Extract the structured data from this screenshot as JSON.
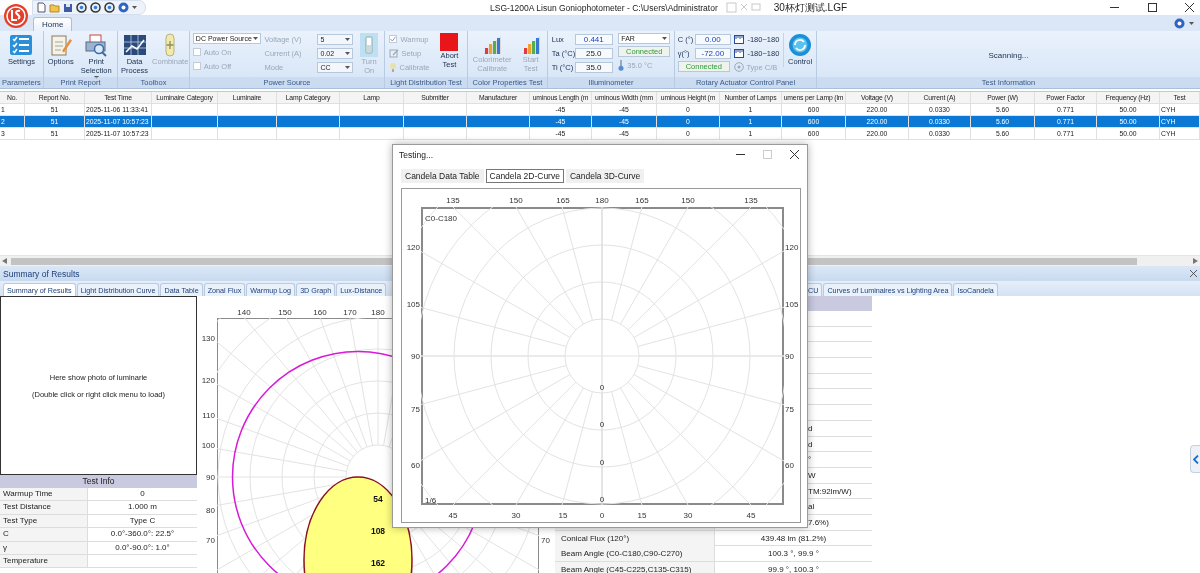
{
  "title_bar": {
    "title": "LSG-1200A Lisun Goniophotometer  - C:\\Users\\Administrator",
    "title_end": "30杯灯测试.LGF"
  },
  "ribbon": {
    "tabs": [
      {
        "label": "Home",
        "selected": true
      }
    ],
    "parameters": {
      "label": "Parameters",
      "settings": {
        "label": "Settings"
      }
    },
    "print_report": {
      "label": "Print Report",
      "options": {
        "label": "Options"
      },
      "print_selection": {
        "label": "Print Selection"
      }
    },
    "toolbox": {
      "label": "Toolbox",
      "data_process": {
        "label": "Data Process",
        "disabled": false
      },
      "combinate": {
        "label": "Combinate",
        "disabled": true
      }
    },
    "power_source": {
      "label": "Power Source",
      "source": {
        "value": "DC Power Source"
      },
      "auto_on": {
        "label": "Auto On",
        "checked": false,
        "disabled": true
      },
      "auto_off": {
        "label": "Auto Off",
        "checked": false,
        "disabled": true
      },
      "fields": [
        {
          "label": "Voltage (V)",
          "value": "5",
          "disabled": true
        },
        {
          "label": "Current (A)",
          "value": "0.02",
          "disabled": true
        },
        {
          "label": "Mode",
          "value": "CC",
          "disabled": true
        }
      ],
      "turn_on": {
        "label": "Turn On",
        "disabled": true
      }
    },
    "light_distribution": {
      "label": "Light Distribution Test",
      "warmup": {
        "label": "Warmup",
        "checked": true,
        "disabled": true
      },
      "setup": {
        "label": "Setup",
        "disabled": true
      },
      "calibrate": {
        "label": "Calibrate",
        "disabled": true
      },
      "abort": {
        "label": "Abort Test",
        "disabled": false
      }
    },
    "color_properties": {
      "label": "Color Properties Test",
      "colorimeter": {
        "label": "Colorimeter Calibrate",
        "disabled": true
      },
      "start": {
        "label": "Start Test",
        "disabled": true
      }
    },
    "illuminometer": {
      "label": "Illuminometer",
      "readings": [
        {
          "label": "Lux",
          "value": "0.441"
        },
        {
          "label": "Ta (°C)",
          "value": "25.0"
        },
        {
          "label": "Ti (°C)",
          "value": "35.0"
        }
      ],
      "range": {
        "value": "FAR"
      },
      "status": "Connected",
      "temperature": "35.0 °C"
    },
    "rotary": {
      "label": "Rotary Actuator Control Panel",
      "readings": [
        {
          "label": "C (°)",
          "value": "0.00"
        },
        {
          "label": "γ(°)",
          "value": "-72.00"
        }
      ],
      "status": "Connected",
      "ranges": [
        "-180~180",
        "-180~180"
      ],
      "type": {
        "label": "Type C/B",
        "disabled": true
      },
      "control": {
        "label": "Control",
        "disabled": false
      }
    },
    "test_information": {
      "label": "Test Information",
      "status": "Scanning..."
    }
  },
  "results_table": {
    "columns": [
      "No.",
      "Report No.",
      "Test Time",
      "Luminaire Category",
      "Luminaire",
      "Lamp Category",
      "Lamp",
      "Submitter",
      "Manufacturer",
      "uminous Length (m",
      "uminous Width (mm",
      "uminous Height (m",
      "Number of Lamps",
      "umens per Lamp (lm",
      "Voltage (V)",
      "Current (A)",
      "Power (W)",
      "Power Factor",
      "Frequency (Hz)",
      "Test"
    ],
    "rows": [
      {
        "selected": false,
        "cells": [
          "1",
          "51",
          "2025-11-06 11:33:41",
          null,
          null,
          null,
          null,
          null,
          null,
          "-45",
          "-45",
          "0",
          "1",
          "600",
          "220.00",
          "0.0330",
          "5.60",
          "0.771",
          "50.00",
          "CYH"
        ]
      },
      {
        "selected": true,
        "cells": [
          "2",
          "51",
          "2025-11-07 10:57:23",
          null,
          null,
          null,
          null,
          null,
          null,
          "-45",
          "-45",
          "0",
          "1",
          "600",
          "220.00",
          "0.0330",
          "5.60",
          "0.771",
          "50.00",
          "CYH"
        ]
      },
      {
        "selected": false,
        "cells": [
          "3",
          "51",
          "2025-11-07 10:57:23",
          null,
          null,
          null,
          null,
          null,
          null,
          "-45",
          "-45",
          "0",
          "1",
          "600",
          "220.00",
          "0.0330",
          "5.60",
          "0.771",
          "50.00",
          "CYH"
        ]
      }
    ]
  },
  "results_panel": {
    "title": "Summary of Results",
    "tabs_left": [
      {
        "label": "Summary of Results",
        "selected": true
      },
      {
        "label": "Light Distribution Curve",
        "selected": false
      },
      {
        "label": "Data Table",
        "selected": false
      },
      {
        "label": "Zonal Flux",
        "selected": false
      },
      {
        "label": "Warmup Log",
        "selected": false
      },
      {
        "label": "3D Graph",
        "selected": false
      },
      {
        "label": "Lux-Distance",
        "selected": false
      }
    ],
    "tabs_right": [
      {
        "label": "CU",
        "selected": false
      },
      {
        "label": "Curves of Luminaires vs Lighting Area",
        "selected": false
      },
      {
        "label": "IsoCandela",
        "selected": false
      }
    ],
    "photo": {
      "line1": "Here show photo of luminarie",
      "line2": "(Double click or right click menu to load)"
    },
    "test_info": {
      "title": "Test Info",
      "rows": [
        {
          "label": "Warmup Time",
          "value": "0"
        },
        {
          "label": "Test Distance",
          "value": "1.000 m"
        },
        {
          "label": "Test Type",
          "value": "Type C"
        },
        {
          "label": "C",
          "value": "0.0°-360.0°: 22.5°"
        },
        {
          "label": "γ",
          "value": "0.0°-90.0°: 1.0°"
        },
        {
          "label": "Temperature",
          "value": null
        }
      ]
    },
    "chart": {
      "top_ticks": [
        "140",
        "150",
        "160",
        "170",
        "180"
      ],
      "left_ticks": [
        "130",
        "120",
        "110",
        "100",
        "90",
        "80",
        "70"
      ],
      "right_ticks": [
        "70"
      ],
      "ring_labels": [
        "54",
        "108",
        "162"
      ]
    },
    "summary_rows": [
      {
        "label": null,
        "value": "d"
      },
      {
        "label": null,
        "value": "d"
      },
      {
        "label": null,
        "value": "°"
      },
      {
        "label": null,
        "value": "W"
      },
      {
        "label": null,
        "value": "TM:92lm/W)"
      },
      {
        "label": null,
        "value": "al"
      },
      {
        "label": null,
        "value": "7.6%)"
      },
      {
        "label": "Conical Flux (120°)",
        "value": "439.48 lm (81.2%)"
      },
      {
        "label": "Beam Angle (C0-C180,C90-C270)",
        "value": "100.3 °, 99.9 °"
      },
      {
        "label": "Beam Angle (C45-C225,C135-C315)",
        "value": "99.9 °, 100.3 °"
      }
    ]
  },
  "dialog": {
    "title": "Testing...",
    "tabs": [
      {
        "label": "Candela Data Table",
        "selected": false
      },
      {
        "label": "Candela 2D-Curve",
        "selected": true
      },
      {
        "label": "Candela 3D-Curve",
        "selected": false
      }
    ],
    "plot": {
      "label": "C0-C180",
      "page": "1/6",
      "top_ticks": [
        "135",
        "150",
        "165",
        "180",
        "165",
        "150",
        "135"
      ],
      "left_ticks": [
        "120",
        "105",
        "90",
        "75",
        "60"
      ],
      "right_ticks": [
        "120",
        "105",
        "90",
        "75",
        "60"
      ],
      "bottom_ticks": [
        "45",
        "30",
        "15",
        "0",
        "15",
        "30",
        "45"
      ],
      "center_values": [
        "0",
        "0",
        "0",
        "0"
      ]
    }
  }
}
